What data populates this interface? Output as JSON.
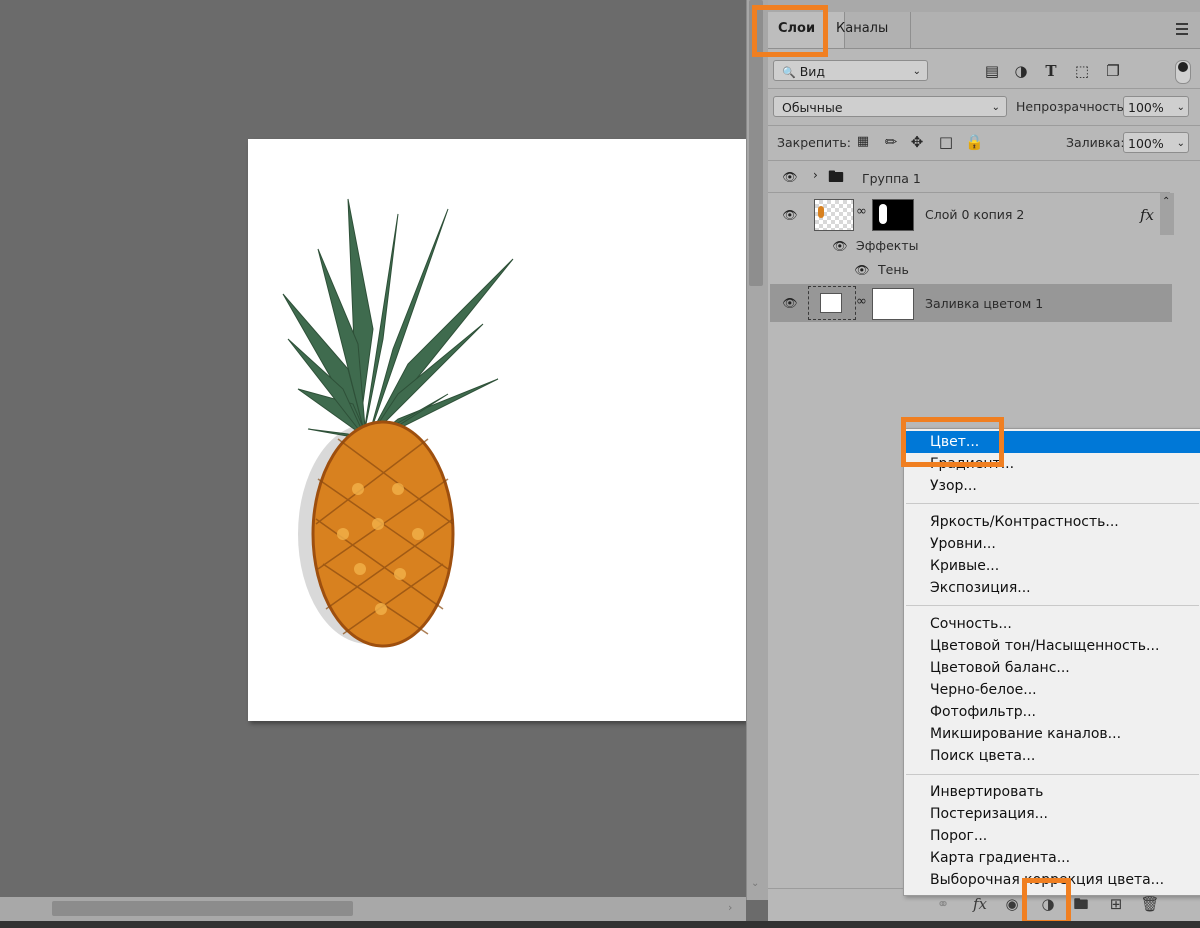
{
  "panel": {
    "tabs": [
      {
        "label": "Слои"
      },
      {
        "label": "Каналы"
      }
    ],
    "filter": {
      "icon": "search-icon",
      "label": "Вид"
    },
    "filter_icons": [
      "image-filter-icon",
      "adjustment-filter-icon",
      "type-filter-icon",
      "shape-filter-icon",
      "smart-object-filter-icon"
    ],
    "blend_mode": "Обычные",
    "opacity_label": "Непрозрачность:",
    "opacity_value": "100%",
    "lock_label": "Закрепить:",
    "lock_icons": [
      "lock-transparent-icon",
      "lock-paint-icon",
      "lock-move-icon",
      "lock-artboard-icon",
      "lock-all-icon"
    ],
    "fill_label": "Заливка:",
    "fill_value": "100%",
    "layers": [
      {
        "name": "Группа 1",
        "type": "group"
      },
      {
        "name": "Слой 0 копия 2",
        "fx": "fx"
      },
      {
        "name": "Эффекты"
      },
      {
        "name": "Тень"
      },
      {
        "name": "Заливка цветом 1",
        "selected": true
      }
    ]
  },
  "menu": {
    "items": [
      "Цвет...",
      "Градиент...",
      "Узор...",
      "Яркость/Контрастность...",
      "Уровни...",
      "Кривые...",
      "Экспозиция...",
      "Сочность...",
      "Цветовой тон/Насыщенность...",
      "Цветовой баланс...",
      "Черно-белое...",
      "Фотофильтр...",
      "Микширование каналов...",
      "Поиск цвета...",
      "Инвертировать",
      "Постеризация...",
      "Порог...",
      "Карта градиента...",
      "Выборочная коррекция цвета..."
    ],
    "highlight_color": "#0078d7"
  },
  "bottom_icons": [
    "link-icon",
    "fx-icon",
    "mask-icon",
    "adjustment-layer-icon",
    "folder-icon",
    "new-layer-icon",
    "trash-icon"
  ],
  "accent_color": "#f07f21"
}
